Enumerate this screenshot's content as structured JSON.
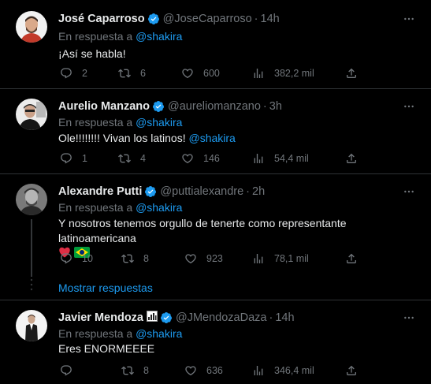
{
  "colors": {
    "background": "#000000",
    "text": "#e7e9ea",
    "muted": "#71767b",
    "accent": "#1d9bf0",
    "divider": "#2f3336",
    "verified": "#1d9bf0"
  },
  "tweets": [
    {
      "name": "José Caparroso",
      "handle": "@JoseCaparroso",
      "dot": "·",
      "time": "14h",
      "reply_prefix": "En respuesta a",
      "reply_to": "@shakira",
      "text": "¡Así se habla!",
      "replies": "2",
      "retweets": "6",
      "likes": "600",
      "views": "382,2 mil"
    },
    {
      "name": "Aurelio Manzano",
      "handle": "@aureliomanzano",
      "dot": "·",
      "time": "3h",
      "reply_prefix": "En respuesta a",
      "reply_to": "@shakira",
      "text": "Ole!!!!!!!! Vivan los latinos!",
      "text_mention": "@shakira",
      "replies": "1",
      "retweets": "4",
      "likes": "146",
      "views": "54,4 mil"
    },
    {
      "name": "Alexandre Putti",
      "handle": "@puttialexandre",
      "dot": "·",
      "time": "2h",
      "reply_prefix": "En respuesta a",
      "reply_to": "@shakira",
      "text": "Y nosotros tenemos orgullo de tenerte como representante latinoamericana",
      "replies": "10",
      "retweets": "8",
      "likes": "923",
      "views": "78,1 mil"
    },
    {
      "name": "Javier Mendoza",
      "handle": "@JMendozaDaza",
      "dot": "·",
      "time": "14h",
      "reply_prefix": "En respuesta a",
      "reply_to": "@shakira",
      "text": "Eres ENORMEEEE",
      "replies": "",
      "retweets": "8",
      "likes": "636",
      "views": "346,4 mil"
    }
  ],
  "show_replies": "Mostrar respuestas",
  "icons": [
    "verified-badge-icon",
    "more-icon",
    "reply-icon",
    "retweet-icon",
    "like-icon",
    "views-icon",
    "share-icon",
    "heart-emoji",
    "brazil-flag-emoji",
    "stock-chart-emoji"
  ]
}
